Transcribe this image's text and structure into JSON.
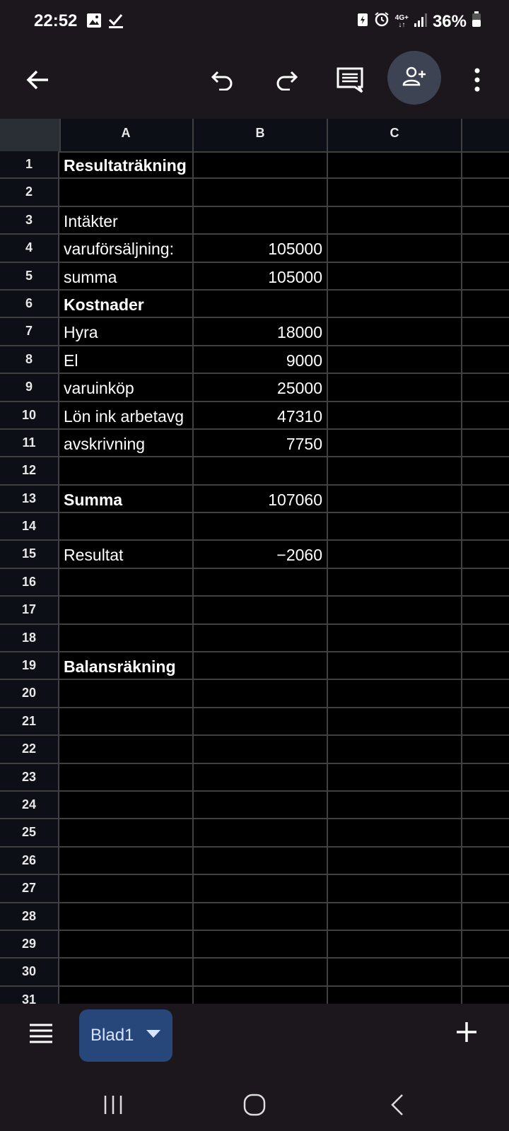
{
  "status": {
    "time": "22:52",
    "network_top": "4G+",
    "battery": "36%"
  },
  "toolbar": {
    "back": "back-arrow-icon",
    "undo": "undo-icon",
    "redo": "redo-icon",
    "comments": "comment-icon",
    "share": "add-person-icon",
    "more": "more-vert-icon"
  },
  "sheet": {
    "columns": [
      "A",
      "B",
      "C"
    ],
    "rows": [
      {
        "n": "1",
        "a": "Resultaträkning",
        "b": "",
        "bold": true
      },
      {
        "n": "2",
        "a": "",
        "b": ""
      },
      {
        "n": "3",
        "a": "Intäkter",
        "b": ""
      },
      {
        "n": "4",
        "a": "varuförsäljning:",
        "b": "105000"
      },
      {
        "n": "5",
        "a": "summa",
        "b": "105000"
      },
      {
        "n": "6",
        "a": "Kostnader",
        "b": "",
        "bold": true
      },
      {
        "n": "7",
        "a": "Hyra",
        "b": "18000"
      },
      {
        "n": "8",
        "a": "El",
        "b": "9000"
      },
      {
        "n": "9",
        "a": "varuinköp",
        "b": "25000"
      },
      {
        "n": "10",
        "a": "Lön ink arbetavg",
        "b": "47310"
      },
      {
        "n": "11",
        "a": "avskrivning",
        "b": "7750"
      },
      {
        "n": "12",
        "a": "",
        "b": ""
      },
      {
        "n": "13",
        "a": "Summa",
        "b": "107060",
        "bold": true
      },
      {
        "n": "14",
        "a": "",
        "b": ""
      },
      {
        "n": "15",
        "a": "Resultat",
        "b": "−2060"
      },
      {
        "n": "16",
        "a": "",
        "b": ""
      },
      {
        "n": "17",
        "a": "",
        "b": ""
      },
      {
        "n": "18",
        "a": "",
        "b": ""
      },
      {
        "n": "19",
        "a": "Balansräkning",
        "b": "",
        "bold": true
      },
      {
        "n": "20",
        "a": "",
        "b": ""
      },
      {
        "n": "21",
        "a": "",
        "b": ""
      },
      {
        "n": "22",
        "a": "",
        "b": ""
      },
      {
        "n": "23",
        "a": "",
        "b": ""
      },
      {
        "n": "24",
        "a": "",
        "b": ""
      },
      {
        "n": "25",
        "a": "",
        "b": ""
      },
      {
        "n": "26",
        "a": "",
        "b": ""
      },
      {
        "n": "27",
        "a": "",
        "b": ""
      },
      {
        "n": "28",
        "a": "",
        "b": ""
      },
      {
        "n": "29",
        "a": "",
        "b": ""
      },
      {
        "n": "30",
        "a": "",
        "b": ""
      },
      {
        "n": "31",
        "a": "",
        "b": ""
      }
    ]
  },
  "sheets_bar": {
    "tab_label": "Blad1"
  },
  "colors": {
    "accent_chip": "#27477a",
    "share_bg": "#3d4352",
    "grid_line": "#404040"
  }
}
